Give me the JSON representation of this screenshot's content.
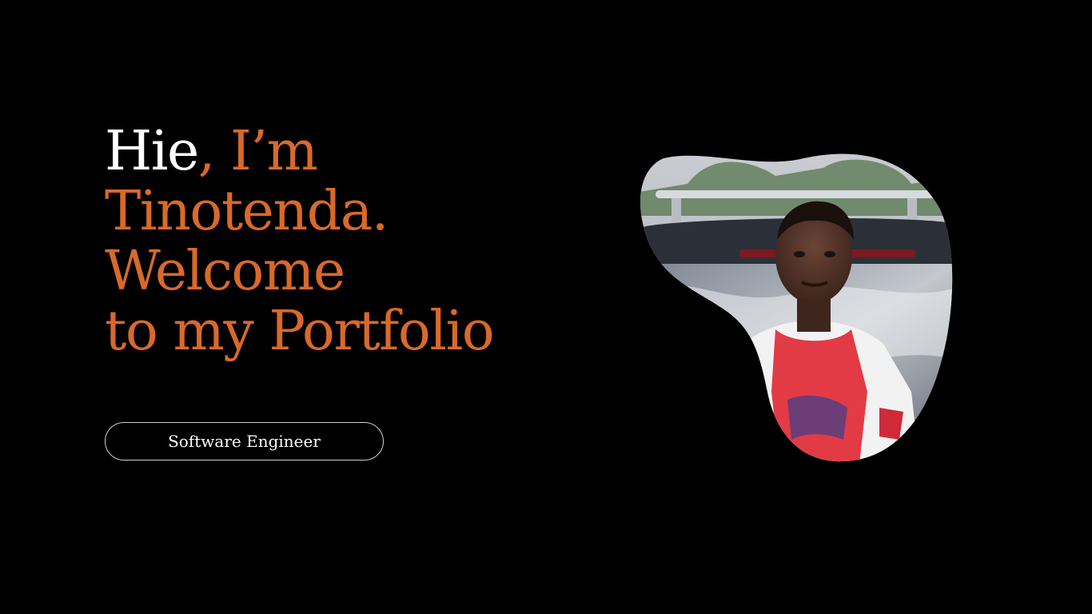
{
  "hero": {
    "greeting": "Hie",
    "name_line_1": ", I’m",
    "name_line_2": "Tinotenda.",
    "welcome_line_1": "Welcome",
    "welcome_line_2": "to my Portfolio"
  },
  "role": {
    "label": "Software Engineer"
  },
  "colors": {
    "background": "#000000",
    "accent": "#d9692a",
    "text_primary": "#ffffff",
    "pill_border": "#cfcfcf"
  }
}
